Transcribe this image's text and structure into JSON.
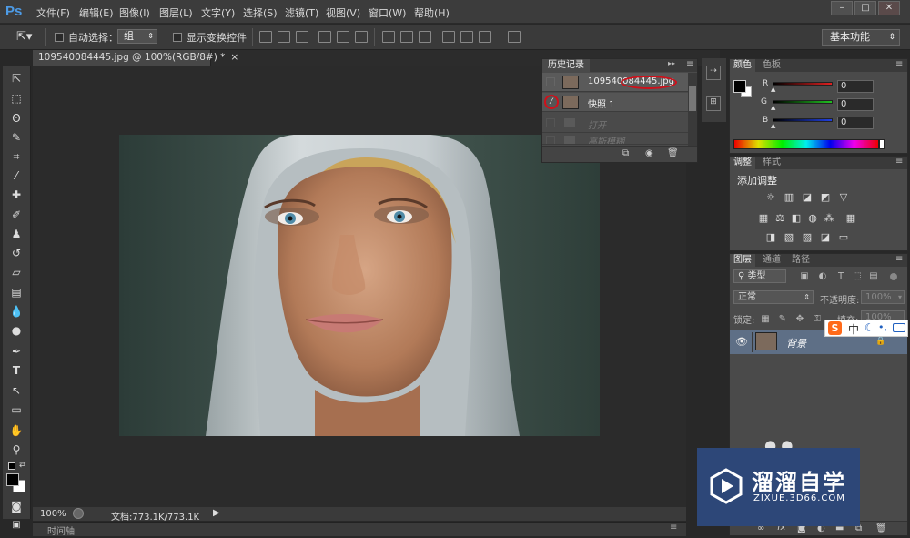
{
  "app": {
    "logo": "Ps"
  },
  "menu": [
    "文件(F)",
    "编辑(E)",
    "图像(I)",
    "图层(L)",
    "文字(Y)",
    "选择(S)",
    "滤镜(T)",
    "视图(V)",
    "窗口(W)",
    "帮助(H)"
  ],
  "window_controls": {
    "minimize": "–",
    "maximize": "□",
    "close": "✕"
  },
  "options": {
    "auto_select_label": "自动选择：",
    "auto_select_value": "组",
    "show_transform_label": "显示变换控件",
    "workspace": "基本功能"
  },
  "document": {
    "tab_title": "109540084445.jpg @ 100%(RGB/8#) *",
    "zoom": "100%",
    "doc_size": "文档:773.1K/773.1K"
  },
  "timeline_label": "时间轴",
  "history": {
    "title": "历史记录",
    "items": [
      {
        "name": "109540084445.jpg"
      },
      {
        "name": "快照 1"
      },
      {
        "name": "打开"
      },
      {
        "name": "高斯模糊"
      }
    ]
  },
  "color_panel": {
    "tabs": [
      "颜色",
      "色板"
    ],
    "channels": [
      {
        "label": "R",
        "value": "0",
        "color": "#d02020"
      },
      {
        "label": "G",
        "value": "0",
        "color": "#20b020"
      },
      {
        "label": "B",
        "value": "0",
        "color": "#2040d0"
      }
    ]
  },
  "adjust_panel": {
    "tabs": [
      "调整",
      "样式"
    ],
    "title": "添加调整"
  },
  "layers_panel": {
    "tabs": [
      "图层",
      "通道",
      "路径"
    ],
    "kind_filter": "类型",
    "blend_mode": "正常",
    "opacity_label": "不透明度:",
    "opacity_value": "100%",
    "lock_label": "锁定:",
    "fill_label": "填充:",
    "fill_value": "100%",
    "layers": [
      {
        "name": "背景"
      }
    ]
  },
  "ime": {
    "brand": "S",
    "mode": "中"
  },
  "watermark": {
    "title": "溜溜自学",
    "url": "ZIXUE.3D66.COM"
  },
  "colors": {
    "accent_blue": "#4d9be6",
    "annotation_red": "#d0101a",
    "watermark_bg": "#2d4778"
  }
}
